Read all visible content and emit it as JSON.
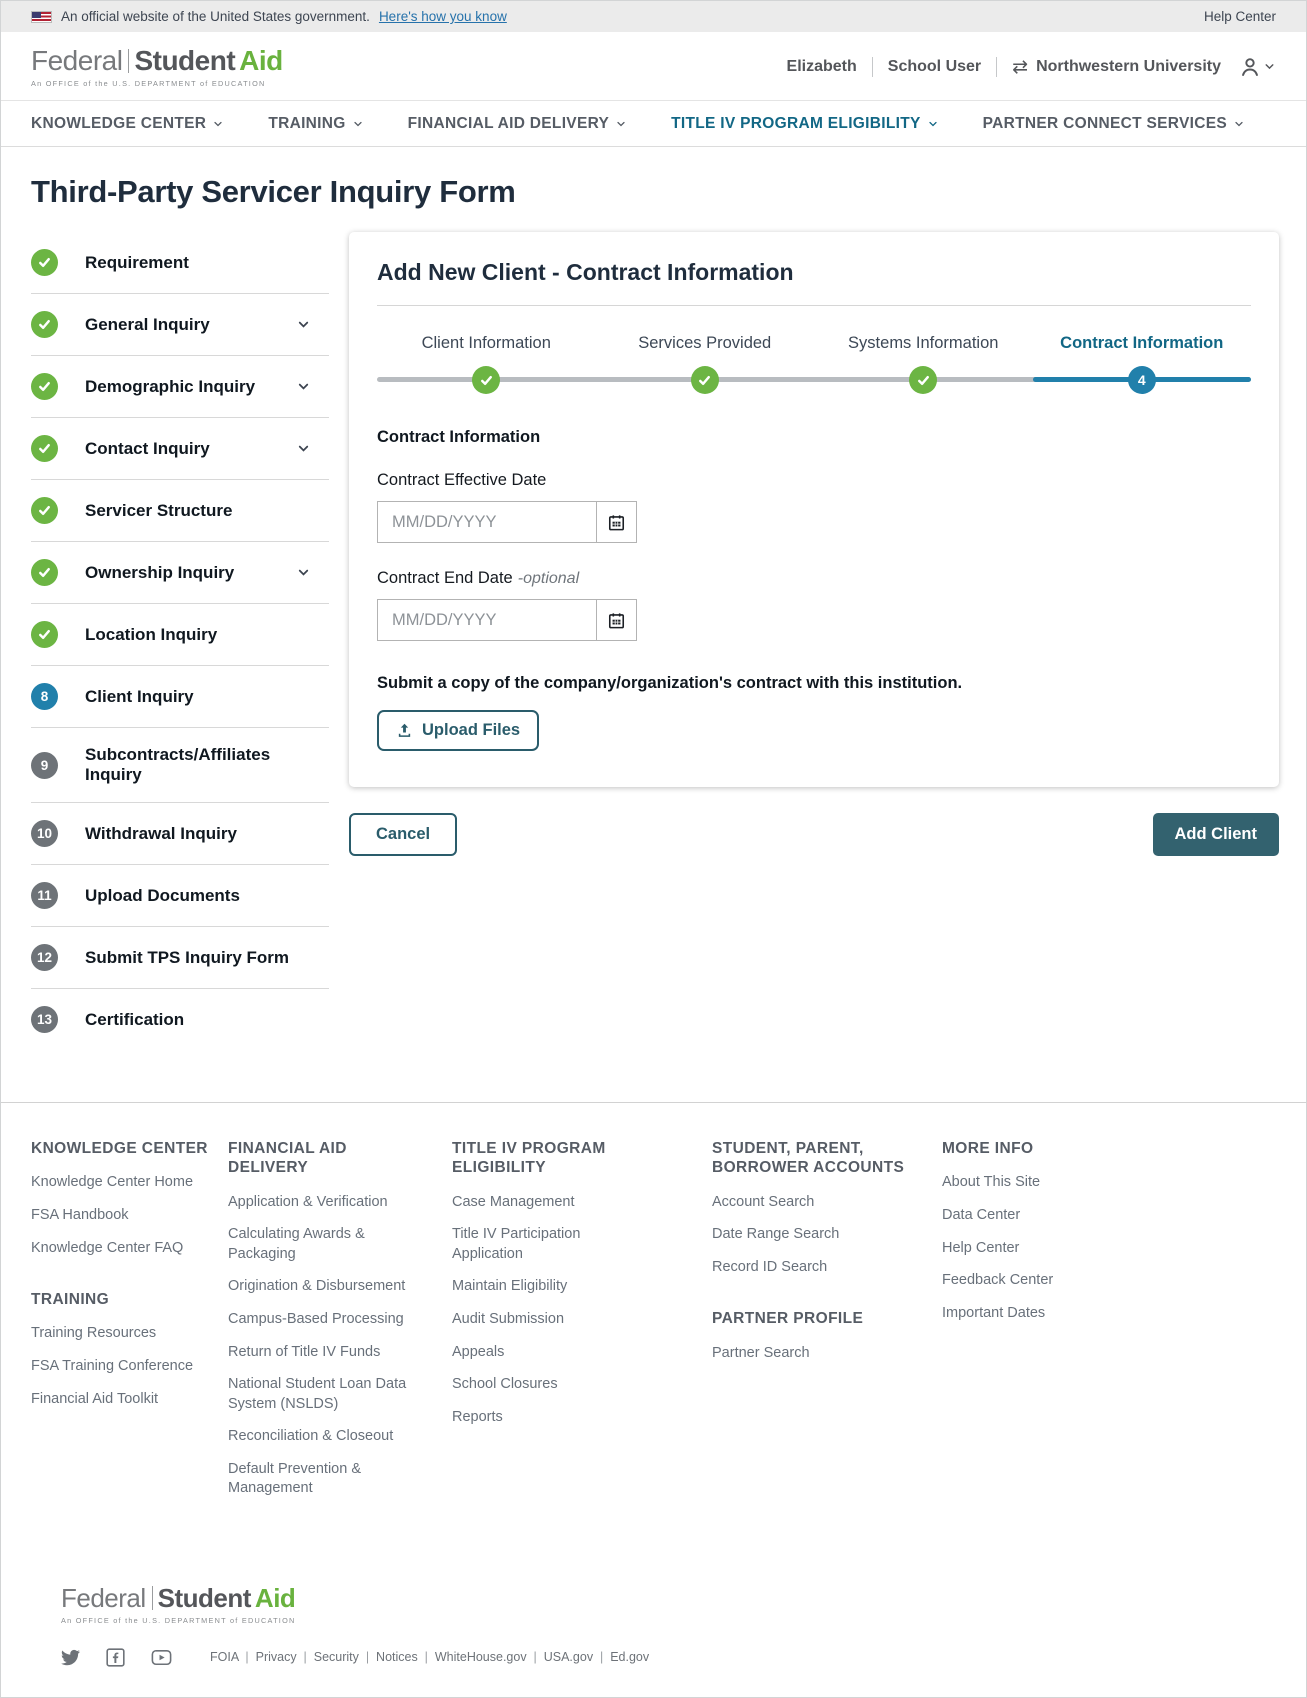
{
  "colors": {
    "green": "#6cb543",
    "blue": "#2180ab",
    "accent": "#126785",
    "teal": "#2a5c6b",
    "teal-dark": "#33626f",
    "link": "#2672ab"
  },
  "banner": {
    "text": "An official website of the United States government.",
    "link": "Here's how you know",
    "help": "Help Center"
  },
  "header": {
    "logo": {
      "federal": "Federal",
      "student": "Student",
      "aid": "Aid",
      "tagline": "An OFFICE of the U.S. DEPARTMENT of EDUCATION"
    },
    "user_name": "Elizabeth",
    "user_role": "School User",
    "organization": "Northwestern University"
  },
  "nav": {
    "items": [
      {
        "label": "KNOWLEDGE CENTER",
        "state": ""
      },
      {
        "label": "TRAINING",
        "state": ""
      },
      {
        "label": "FINANCIAL AID DELIVERY",
        "state": ""
      },
      {
        "label": "TITLE IV PROGRAM ELIGIBILITY",
        "state": "active"
      },
      {
        "label": "PARTNER CONNECT SERVICES",
        "state": ""
      }
    ]
  },
  "page": {
    "title": "Third-Party Servicer Inquiry Form"
  },
  "sidebar": {
    "items": [
      {
        "label": "Requirement",
        "state": "done"
      },
      {
        "label": "General Inquiry",
        "state": "done",
        "chevron": true
      },
      {
        "label": "Demographic Inquiry",
        "state": "done",
        "chevron": true
      },
      {
        "label": "Contact Inquiry",
        "state": "done",
        "chevron": true
      },
      {
        "label": "Servicer Structure",
        "state": "done"
      },
      {
        "label": "Ownership Inquiry",
        "state": "done",
        "chevron": true
      },
      {
        "label": "Location Inquiry",
        "state": "done"
      },
      {
        "label": "Client Inquiry",
        "state": "active",
        "number": "8"
      },
      {
        "label": "Subcontracts/Affiliates Inquiry",
        "state": "todo",
        "number": "9"
      },
      {
        "label": "Withdrawal Inquiry",
        "state": "todo",
        "number": "10"
      },
      {
        "label": "Upload Documents",
        "state": "todo",
        "number": "11"
      },
      {
        "label": "Submit TPS Inquiry Form",
        "state": "todo",
        "number": "12"
      },
      {
        "label": "Certification",
        "state": "todo",
        "number": "13"
      }
    ]
  },
  "card": {
    "title": "Add New Client - Contract Information",
    "steps": [
      {
        "label": "Client Information",
        "state": "done"
      },
      {
        "label": "Services Provided",
        "state": "done"
      },
      {
        "label": "Systems Information",
        "state": "done"
      },
      {
        "label": "Contract Information",
        "state": "active",
        "number": "4"
      }
    ],
    "section_heading": "Contract Information",
    "fields": [
      {
        "label": "Contract Effective Date",
        "placeholder": "MM/DD/YYYY"
      },
      {
        "label": "Contract End Date",
        "optional": "-optional",
        "placeholder": "MM/DD/YYYY"
      }
    ],
    "upload_text": "Submit a copy of the company/organization's contract with this institution.",
    "upload_button": "Upload Files"
  },
  "actions": {
    "cancel": "Cancel",
    "submit": "Add Client"
  },
  "footer": {
    "columns": [
      {
        "groups": [
          {
            "heading": "KNOWLEDGE CENTER",
            "links": [
              "Knowledge Center Home",
              "FSA Handbook",
              "Knowledge Center FAQ"
            ]
          },
          {
            "heading": "TRAINING",
            "links": [
              "Training Resources",
              "FSA Training Conference",
              "Financial Aid Toolkit"
            ]
          }
        ]
      },
      {
        "groups": [
          {
            "heading": "FINANCIAL AID DELIVERY",
            "links": [
              "Application & Verification",
              "Calculating Awards & Packaging",
              "Origination & Disbursement",
              "Campus-Based Processing",
              "Return of Title IV Funds",
              "National Student Loan Data System (NSLDS)",
              "Reconciliation & Closeout",
              "Default Prevention & Management"
            ]
          }
        ]
      },
      {
        "groups": [
          {
            "heading": "TITLE IV PROGRAM ELIGIBILITY",
            "links": [
              "Case Management",
              "Title IV Participation Application",
              "Maintain Eligibility",
              "Audit Submission",
              "Appeals",
              "School Closures",
              "Reports"
            ]
          }
        ]
      },
      {
        "groups": [
          {
            "heading": "STUDENT, PARENT, BORROWER ACCOUNTS",
            "links": [
              "Account Search",
              "Date Range Search",
              "Record ID Search"
            ]
          },
          {
            "heading": "PARTNER PROFILE",
            "links": [
              "Partner Search"
            ]
          }
        ]
      },
      {
        "groups": [
          {
            "heading": "MORE INFO",
            "links": [
              "About This Site",
              "Data Center",
              "Help Center",
              "Feedback Center",
              "Important Dates"
            ]
          }
        ]
      }
    ],
    "social_icons": [
      "twitter-icon",
      "facebook-icon",
      "youtube-icon"
    ],
    "legal_links": [
      "FOIA",
      "Privacy",
      "Security",
      "Notices",
      "WhiteHouse.gov",
      "USA.gov",
      "Ed.gov"
    ]
  }
}
